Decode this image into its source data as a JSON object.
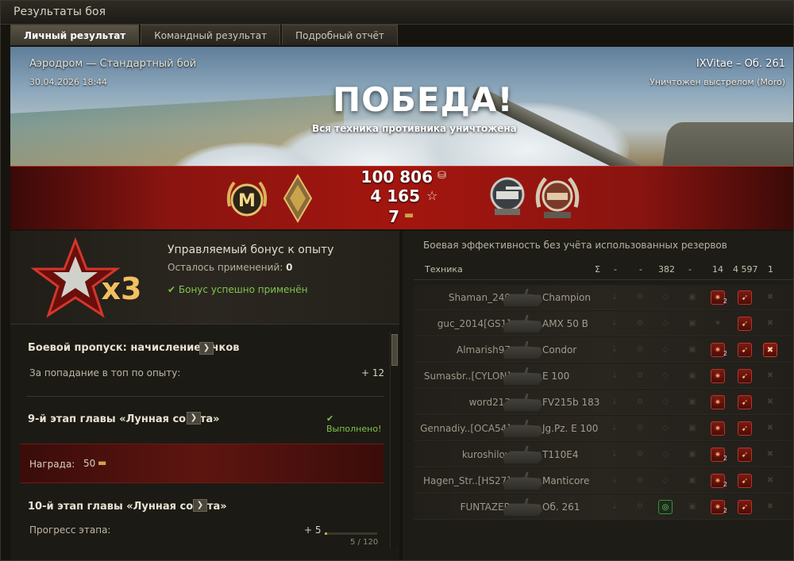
{
  "window": {
    "title": "Результаты боя"
  },
  "tabs": [
    {
      "label": "Личный результат",
      "active": true
    },
    {
      "label": "Командный результат",
      "active": false
    },
    {
      "label": "Подробный отчёт",
      "active": false
    }
  ],
  "hero": {
    "map_mode": "Аэродром — Стандартный бой",
    "datetime": "30.04.2026 18:44",
    "player_vehicle": "IXVitae – Об. 261",
    "killed_by": "Уничтожен выстрелом (Moro)",
    "result": "ПОБЕДА!",
    "result_sub": "Вся техника противника уничтожена"
  },
  "stats": {
    "credits": "100 806",
    "experience": "4 165",
    "crystals": "7",
    "credits_icon": "credits-icon",
    "exp_icon": "star-icon",
    "bonds_icon": "bonds-icon"
  },
  "medals": {
    "mastery_letter": "М",
    "mastery_icon": "mastery-badge-icon",
    "diamond_icon": "gold-diamond-badge-icon",
    "right1_icon": "tank-medal-icon",
    "right2_icon": "laurel-medal-icon"
  },
  "bonus": {
    "multiplier": "x3",
    "title": "Управляемый бонус к опыту",
    "remaining_label": "Осталось применений:",
    "remaining_value": "0",
    "status": "Бонус успешно применён"
  },
  "battle_pass": {
    "title": "Боевой пропуск: начисление очков",
    "row_label": "За попадание в топ по опыту:",
    "row_value": "+ 12"
  },
  "stage9": {
    "title": "9-й этап главы «Лунная соната»",
    "status": "Выполнено!",
    "reward_label": "Награда:",
    "reward_value": "50"
  },
  "stage10": {
    "title": "10-й этап главы «Лунная соната»",
    "progress_label": "Прогресс этапа:",
    "progress_delta": "+ 5",
    "progress_text": "5 / 120",
    "progress_fraction": 0.042
  },
  "efficiency": {
    "title": "Боевая эффективность без учёта использованных резервов",
    "columns": [
      "Техника",
      "Σ",
      "-",
      "-",
      "382",
      "-",
      "14",
      "4 597",
      "1"
    ],
    "players": [
      {
        "name": "Shaman_249",
        "vehicle": "Champion",
        "spot": false,
        "crit": 2,
        "kill": true,
        "fire": false
      },
      {
        "name": "guc_2014[GS1]",
        "vehicle": "AMX 50 B",
        "spot": false,
        "crit": 0,
        "kill": true,
        "fire": false
      },
      {
        "name": "Almarish97",
        "vehicle": "Condor",
        "spot": false,
        "crit": 2,
        "kill": true,
        "fire": true
      },
      {
        "name": "Sumasbr..[CYLON]",
        "vehicle": "E 100",
        "spot": false,
        "crit": 1,
        "kill": true,
        "fire": false
      },
      {
        "name": "word213",
        "vehicle": "FV215b 183",
        "spot": false,
        "crit": 1,
        "kill": true,
        "fire": false
      },
      {
        "name": "Gennadiy..[OCA54]",
        "vehicle": "Jg.Pz. E 100",
        "spot": false,
        "crit": 1,
        "kill": true,
        "fire": false
      },
      {
        "name": "kuroshilov",
        "vehicle": "T110E4",
        "spot": false,
        "crit": 2,
        "kill": true,
        "fire": false
      },
      {
        "name": "Hagen_Str..[HS27]",
        "vehicle": "Manticore",
        "spot": false,
        "crit": 2,
        "kill": true,
        "fire": false
      },
      {
        "name": "FUNTAZER",
        "vehicle": "Об. 261",
        "spot": true,
        "crit": 2,
        "kill": true,
        "fire": false
      }
    ]
  },
  "colors": {
    "victory_band": "#a3160f",
    "ok_green": "#7fc44f",
    "accent_gold": "#c9a44b"
  }
}
